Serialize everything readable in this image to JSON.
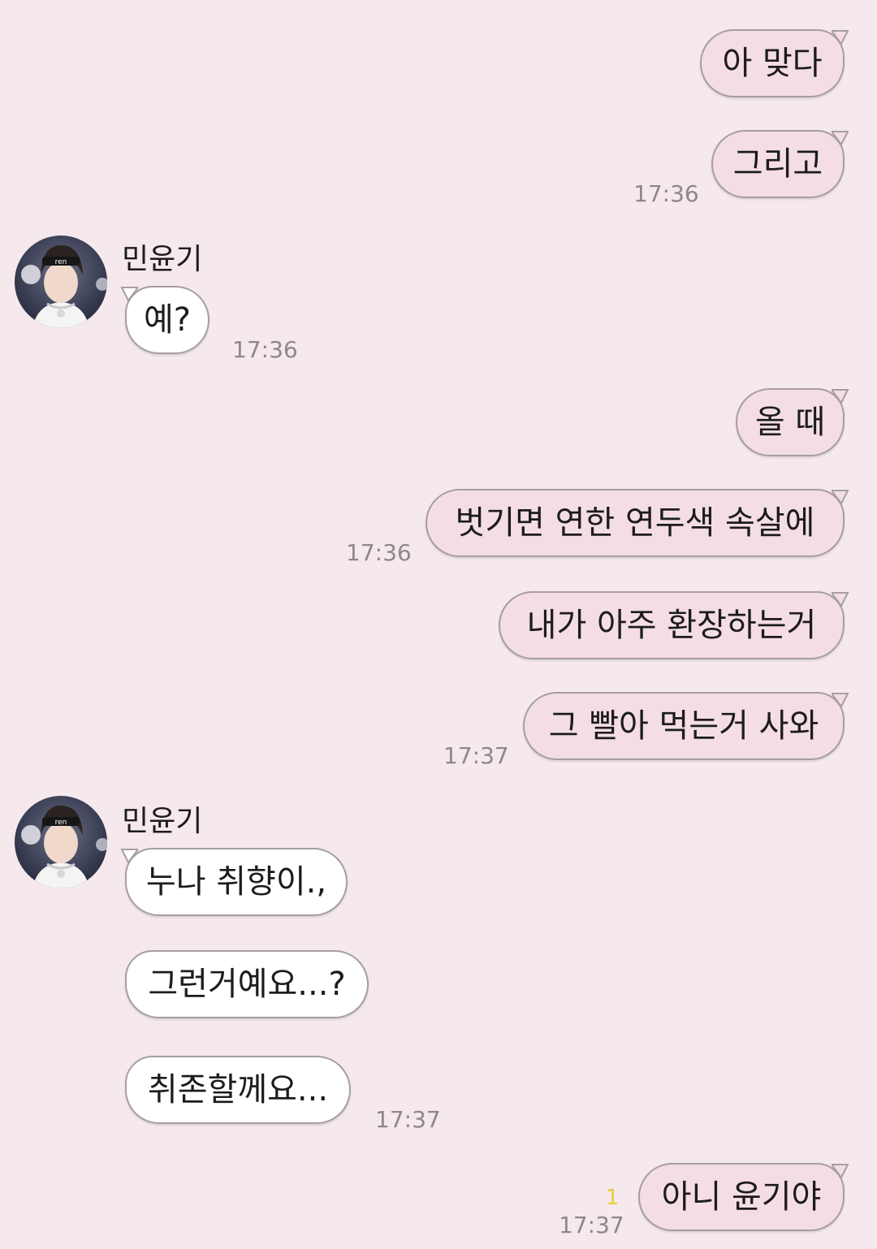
{
  "chat": {
    "partner_name": "민윤기",
    "messages": [
      {
        "text": "아 맞다"
      },
      {
        "text": "그리고",
        "time": "17:36"
      },
      {
        "text": "예?",
        "time": "17:36"
      },
      {
        "text": "올 때"
      },
      {
        "text": "벗기면 연한 연두색 속살에",
        "time": "17:36"
      },
      {
        "text": "내가 아주 환장하는거"
      },
      {
        "text": "그 빨아 먹는거 사와",
        "time": "17:37"
      },
      {
        "text": "누나 취향이.,"
      },
      {
        "text": "그런거예요...?"
      },
      {
        "text": "취존할께요...",
        "time": "17:37"
      },
      {
        "text": "아니 윤기야",
        "time": "17:37",
        "unread": "1"
      }
    ]
  },
  "colors": {
    "background": "#f5e9ee",
    "my_bubble": "#f4dde6",
    "their_bubble": "#ffffff",
    "unread": "#e4cf39"
  },
  "icons": [
    "avatar-photo"
  ]
}
